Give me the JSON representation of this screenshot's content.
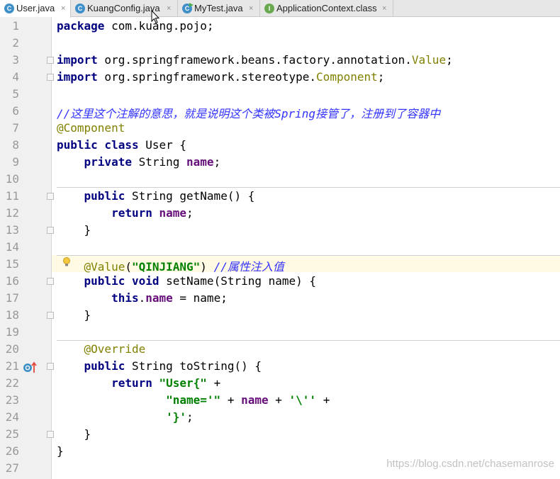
{
  "tabs": [
    {
      "label": "User.java",
      "icon": "class-icon",
      "icon_letter": "C",
      "active": true
    },
    {
      "label": "KuangConfig.java",
      "icon": "class-icon",
      "icon_letter": "C",
      "active": false
    },
    {
      "label": "MyTest.java",
      "icon": "runnable-class-icon",
      "icon_letter": "C",
      "active": false
    },
    {
      "label": "ApplicationContext.class",
      "icon": "interface-icon",
      "icon_letter": "I",
      "active": false
    }
  ],
  "tab_close_glyph": "×",
  "line_numbers": [
    "1",
    "2",
    "3",
    "4",
    "5",
    "6",
    "7",
    "8",
    "9",
    "10",
    "11",
    "12",
    "13",
    "14",
    "15",
    "16",
    "17",
    "18",
    "19",
    "20",
    "21",
    "22",
    "23",
    "24",
    "25",
    "26",
    "27"
  ],
  "code": {
    "l1": {
      "kw": "package",
      "rest": " com.kuang.pojo;"
    },
    "l3": {
      "kw": "import",
      "pre": " org.springframework.beans.factory.annotation.",
      "ann": "Value",
      "post": ";"
    },
    "l4": {
      "kw": "import",
      "pre": " org.springframework.stereotype.",
      "ann": "Component",
      "post": ";"
    },
    "l6": {
      "comment": "//这里这个注解的意思，就是说明这个类被Spring接管了，注册到了容器中"
    },
    "l7": {
      "ann": "@Component"
    },
    "l8": {
      "kw": "public class",
      "rest": " User {"
    },
    "l9": {
      "indent": "    ",
      "kw": "private",
      "type": " String ",
      "field": "name",
      "post": ";"
    },
    "l11": {
      "indent": "    ",
      "kw": "public",
      "rest": " String getName() {"
    },
    "l12": {
      "indent": "        ",
      "kw": "return",
      "sp": " ",
      "field": "name",
      "post": ";"
    },
    "l13": {
      "text": "    }"
    },
    "l15": {
      "indent": "    ",
      "ann": "@Value",
      "p1": "(",
      "str": "\"QINJIANG\"",
      "p2": ") ",
      "comment": "//属性注入值"
    },
    "l16": {
      "indent": "    ",
      "kw": "public void",
      "rest": " setName(String name) {"
    },
    "l17": {
      "indent": "        ",
      "kw": "this",
      "dot": ".",
      "field": "name",
      "post": " = name;"
    },
    "l18": {
      "text": "    }"
    },
    "l20": {
      "indent": "    ",
      "ann": "@Override"
    },
    "l21": {
      "indent": "    ",
      "kw": "public",
      "rest": " String toString() {"
    },
    "l22": {
      "indent": "        ",
      "kw": "return",
      "sp": " ",
      "str": "\"User{\"",
      "post": " +"
    },
    "l23": {
      "indent": "                ",
      "str": "\"name='\"",
      "mid": " + ",
      "field": "name",
      "mid2": " + ",
      "str2": "'\\''",
      "post": " +"
    },
    "l24": {
      "indent": "                ",
      "str": "'}'",
      "post": ";"
    },
    "l25": {
      "text": "    }"
    },
    "l26": {
      "text": "}"
    }
  },
  "watermark": "https://blog.csdn.net/chasemanrose",
  "colors": {
    "keyword": "#000080",
    "field": "#660e7a",
    "annotation": "#808000",
    "string": "#008000",
    "comment": "#3333ff",
    "highlight_line": "#fffae3"
  }
}
